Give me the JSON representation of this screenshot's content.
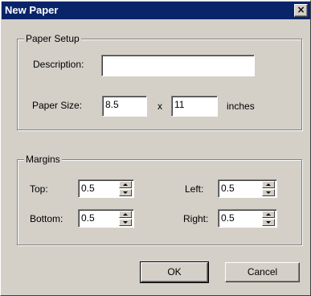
{
  "window": {
    "title": "New Paper",
    "close_glyph": "×"
  },
  "paper_setup": {
    "legend": "Paper Setup",
    "description_label": "Description:",
    "description_value": "",
    "size_label": "Paper Size:",
    "width_value": "8.5",
    "times": "x",
    "height_value": "11",
    "unit": "inches"
  },
  "margins": {
    "legend": "Margins",
    "top_label": "Top:",
    "top_value": "0.5",
    "bottom_label": "Bottom:",
    "bottom_value": "0.5",
    "left_label": "Left:",
    "left_value": "0.5",
    "right_label": "Right:",
    "right_value": "0.5"
  },
  "buttons": {
    "ok": "OK",
    "cancel": "Cancel"
  }
}
